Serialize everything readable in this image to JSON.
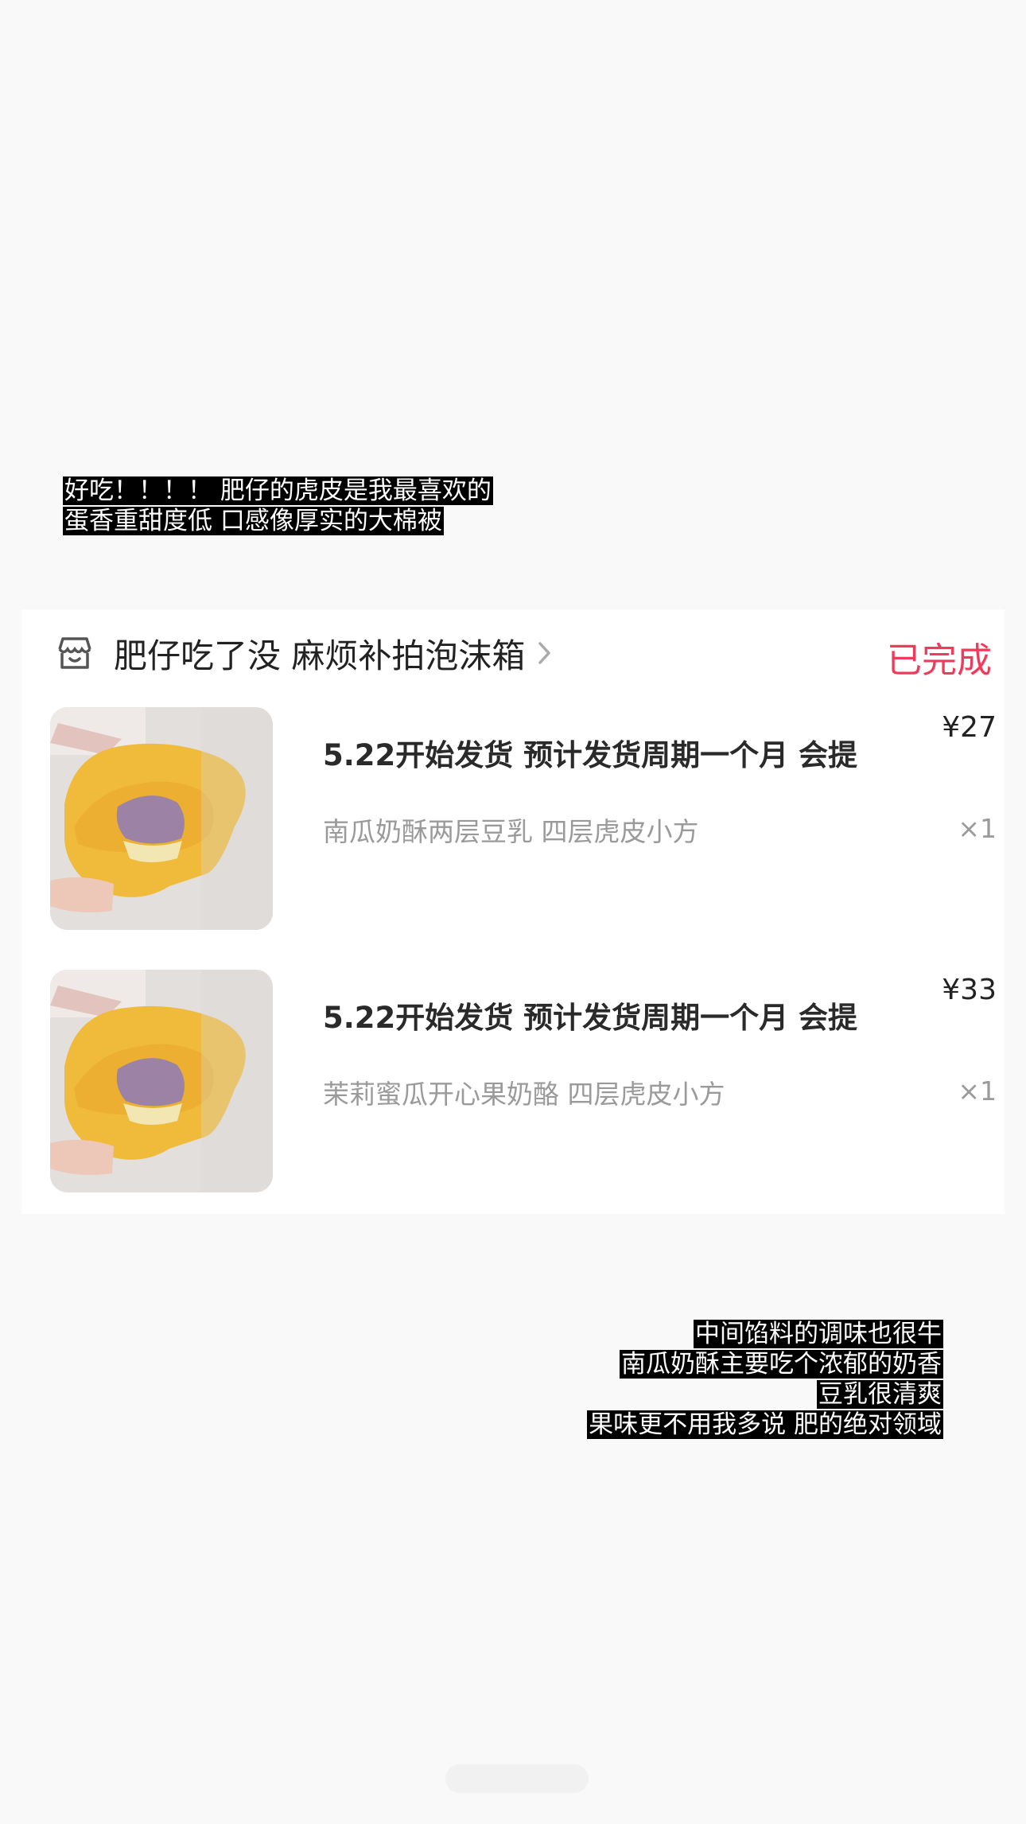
{
  "captions": {
    "top": [
      "好吃！！！！ 肥仔的虎皮是我最喜欢的",
      "蛋香重甜度低  口感像厚实的大棉被"
    ],
    "bottom": [
      "中间馅料的调味也很牛",
      "南瓜奶酥主要吃个浓郁的奶香",
      "豆乳很清爽",
      "果味更不用我多说  肥的绝对领域"
    ]
  },
  "order": {
    "shop_icon": "shop-icon",
    "shop_name": "肥仔吃了没 麻烦补拍泡沫箱",
    "chevron_icon": "chevron-right-icon",
    "status": "已完成",
    "status_color": "#ee3a5b",
    "items": [
      {
        "title": "5.22开始发货 预计发货周期一个月 会提",
        "spec": "南瓜奶酥两层豆乳 四层虎皮小方",
        "price": "¥27",
        "qty": "×1"
      },
      {
        "title": "5.22开始发货 预计发货周期一个月 会提",
        "spec": "茉莉蜜瓜开心果奶酪 四层虎皮小方",
        "price": "¥33",
        "qty": "×1"
      }
    ]
  }
}
